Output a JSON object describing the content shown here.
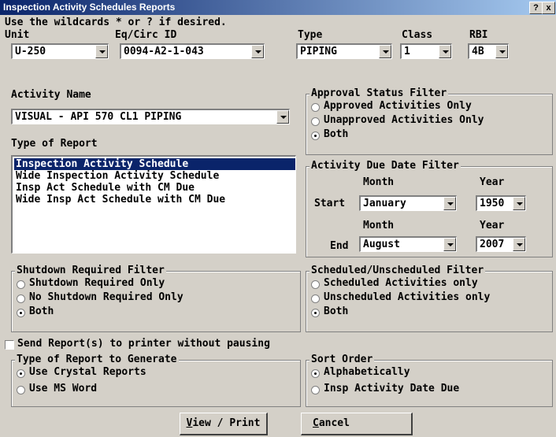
{
  "window": {
    "title": "Inspection Activity Schedules Reports",
    "help_btn": "?",
    "close_btn": "x"
  },
  "hint": "Use the wildcards * or ? if desired.",
  "filters": {
    "unit_label": "Unit",
    "unit_value": "U-250",
    "eqcirc_label": "Eq/Circ ID",
    "eqcirc_value": "0094-A2-1-043",
    "type_label": "Type",
    "type_value": "PIPING",
    "class_label": "Class",
    "class_value": "1",
    "rbi_label": "RBI",
    "rbi_value": "4B"
  },
  "activity": {
    "label": "Activity Name",
    "value": "VISUAL - API 570 CL1 PIPING"
  },
  "report_type": {
    "label": "Type of Report",
    "items": [
      "Inspection Activity Schedule",
      "Wide Inspection Activity Schedule",
      "Insp Act Schedule with CM Due",
      "Wide Insp Act Schedule with CM Due"
    ],
    "selected": 0
  },
  "approval": {
    "title": "Approval Status Filter",
    "options": [
      "Approved Activities Only",
      "Unapproved Activities Only",
      "Both"
    ],
    "checked": 2
  },
  "due_date": {
    "title": "Activity Due Date Filter",
    "month_label": "Month",
    "year_label": "Year",
    "start_label": "Start",
    "start_month": "January",
    "start_year": "1950",
    "end_label": "End",
    "end_month": "August",
    "end_year": "2007"
  },
  "shutdown": {
    "title": "Shutdown Required Filter",
    "options": [
      "Shutdown Required Only",
      "No Shutdown Required Only",
      "Both"
    ],
    "checked": 2
  },
  "scheduled": {
    "title": "Scheduled/Unscheduled Filter",
    "options": [
      "Scheduled Activities only",
      "Unscheduled Activities only",
      "Both"
    ],
    "checked": 2
  },
  "send_printer": {
    "label": "Send Report(s) to printer without pausing",
    "checked": false
  },
  "generate": {
    "title": "Type of Report to Generate",
    "options": [
      "Use Crystal Reports",
      "Use MS Word"
    ],
    "checked": 0
  },
  "sort": {
    "title": "Sort Order",
    "options": [
      "Alphabetically",
      "Insp Activity Date Due"
    ],
    "checked": 0
  },
  "buttons": {
    "view_print_u": "V",
    "view_print_rest": "iew / Print",
    "cancel_u": "C",
    "cancel_rest": "ancel"
  }
}
